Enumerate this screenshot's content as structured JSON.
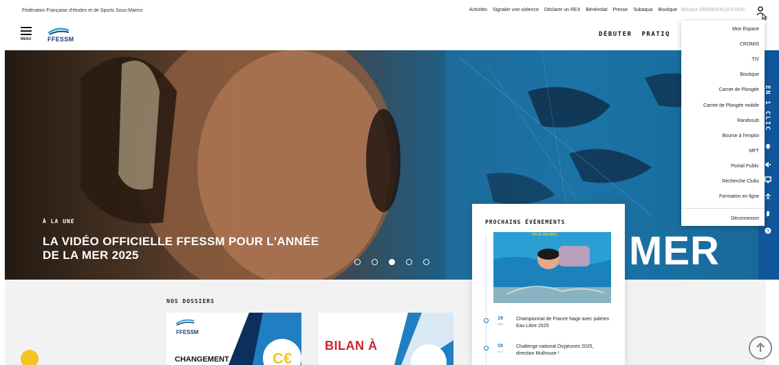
{
  "topbar": {
    "federation_name": "Fédération Française d'études et de Sports Sous-Marins",
    "links": [
      "Activités",
      "Signaler une violence",
      "Déclarer un REX",
      "Bénévolat",
      "Presse",
      "Subaqua",
      "Boutique"
    ],
    "greeting": "Bonjour GRENOUILLES HGC",
    "user_icon": "user-icon"
  },
  "header": {
    "menu_label": "MENU",
    "logo_text": "FFESSM",
    "nav": [
      "DÉBUTER",
      "PRATIQ"
    ]
  },
  "hero": {
    "kicker": "À LA UNE",
    "title": "LA VIDÉO OFFICIELLE FFESSM POUR L'ANNÉE DE LA MER 2025",
    "carousel_count": 5,
    "carousel_active_index": 2,
    "overlay_word": "MER"
  },
  "side_strip": {
    "label": "EN 1 CLIC",
    "icons": [
      "map-pin-icon",
      "megaphone-icon",
      "screen-icon",
      "accessibility-icon",
      "hand-icon",
      "question-icon"
    ]
  },
  "events": {
    "title": "PROCHAINS ÉVÈNEMENTS",
    "image_caption": "NAGE PALMES",
    "items": [
      {
        "day": "19",
        "month": "AVR.",
        "text": "Championnat de France Nage avec palmes Eau Libre 2025"
      },
      {
        "day": "19",
        "month": "OCT.",
        "text": "Challenge national Oxyjeunes 2025, direction Mulhouse !"
      }
    ]
  },
  "dossiers": {
    "title": "NOS DOSSIERS",
    "cards": [
      {
        "logo": "FFESSM",
        "text": "CHANGEMENT"
      },
      {
        "text": "BILAN À"
      }
    ]
  },
  "dropdown": {
    "items": [
      "Mon Espace",
      "CROMIS",
      "TIV",
      "Boutique",
      "Carnet de Plongée",
      "Carnet de Plongée mobile",
      "Randosub",
      "Bourse à l'emploi",
      "MFT",
      "Portail Public",
      "Recherche Clubs",
      "Formation en ligne"
    ],
    "logout": "Déconnexion"
  },
  "colors": {
    "brand_blue": "#10569a",
    "accent_red": "#d0202e",
    "accent_yellow": "#f3c623"
  }
}
